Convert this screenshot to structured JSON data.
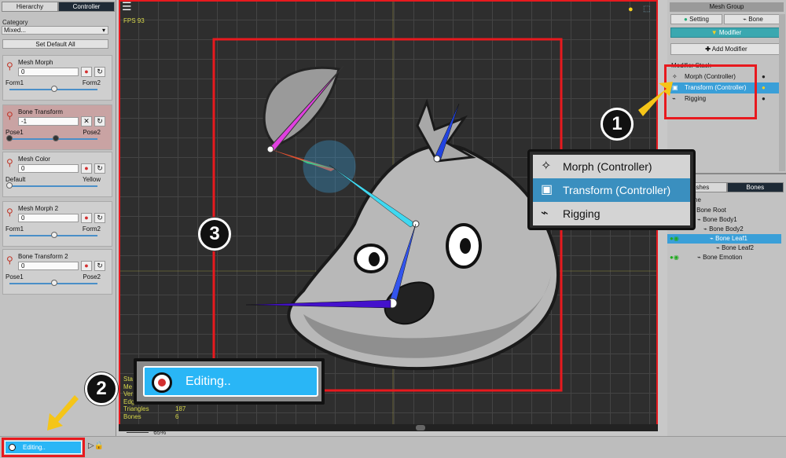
{
  "left_panel": {
    "tabs": [
      "Hierarchy",
      "Controller"
    ],
    "category_label": "Category",
    "category_value": "Mixed...",
    "set_default_label": "Set Default All",
    "controllers": [
      {
        "name": "Mesh Morph",
        "value": "0",
        "left": "Form1",
        "right": "Form2",
        "level": 0.5,
        "highlighted": false,
        "reset_icon": "circle-arrow-icon"
      },
      {
        "name": "Bone Transform",
        "value": "-1",
        "left": "Pose1",
        "right": "Pose2",
        "level": 0.0,
        "highlighted": true,
        "reset_icon": "x-icon"
      },
      {
        "name": "Mesh Color",
        "value": "0",
        "left": "Default",
        "right": "Yellow",
        "level": 0.0,
        "highlighted": false,
        "reset_icon": "circle-arrow-icon"
      },
      {
        "name": "Mesh Morph 2",
        "value": "0",
        "left": "Form1",
        "right": "Form2",
        "level": 0.5,
        "highlighted": false,
        "reset_icon": "circle-arrow-icon"
      },
      {
        "name": "Bone Transform 2",
        "value": "0",
        "left": "Pose1",
        "right": "Pose2",
        "level": 0.5,
        "highlighted": false,
        "reset_icon": "circle-arrow-icon"
      }
    ]
  },
  "viewport": {
    "fps": "FPS 93",
    "stats": [
      {
        "label": "Sta",
        "value": ""
      },
      {
        "label": "Me",
        "value": ""
      },
      {
        "label": "Ver",
        "value": ""
      },
      {
        "label": "Edg",
        "value": ""
      },
      {
        "label": "Triangles",
        "value": "187"
      },
      {
        "label": "Bones",
        "value": "6"
      }
    ],
    "zoom": "65%"
  },
  "right_panel": {
    "header": "Mesh Group",
    "setting_label": "Setting",
    "bone_label": "Bone",
    "modifier_label": "Modifier",
    "add_modifier_label": "Add Modifier",
    "modifier_stack_label": "Modifier Stack",
    "modifiers": [
      {
        "label": "Morph (Controller)",
        "selected": false
      },
      {
        "label": "Transform (Controller)",
        "selected": true
      },
      {
        "label": "Rigging",
        "selected": false
      }
    ],
    "lower_tabs": [
      "Meshes",
      "Bones"
    ],
    "tree_partial_label": "ime",
    "tree": [
      {
        "label": "Bone Root",
        "depth": 0,
        "selected": false
      },
      {
        "label": "Bone Body1",
        "depth": 1,
        "selected": false
      },
      {
        "label": "Bone Body2",
        "depth": 2,
        "selected": false
      },
      {
        "label": "Bone Leaf1",
        "depth": 3,
        "selected": true
      },
      {
        "label": "Bone Leaf2",
        "depth": 4,
        "selected": false
      },
      {
        "label": "Bone Emotion",
        "depth": 1,
        "selected": false
      }
    ]
  },
  "popup_modifiers": [
    "Morph (Controller)",
    "Transform (Controller)",
    "Rigging"
  ],
  "editing": {
    "small_label": "Editing..",
    "big_label": "Editing.."
  },
  "callouts": [
    "1",
    "2",
    "3"
  ],
  "colors": {
    "accent": "#3a9fd8",
    "highlight_red": "#e8191e",
    "arrow_yellow": "#f5c518",
    "editing_bg": "#29b6f6"
  }
}
